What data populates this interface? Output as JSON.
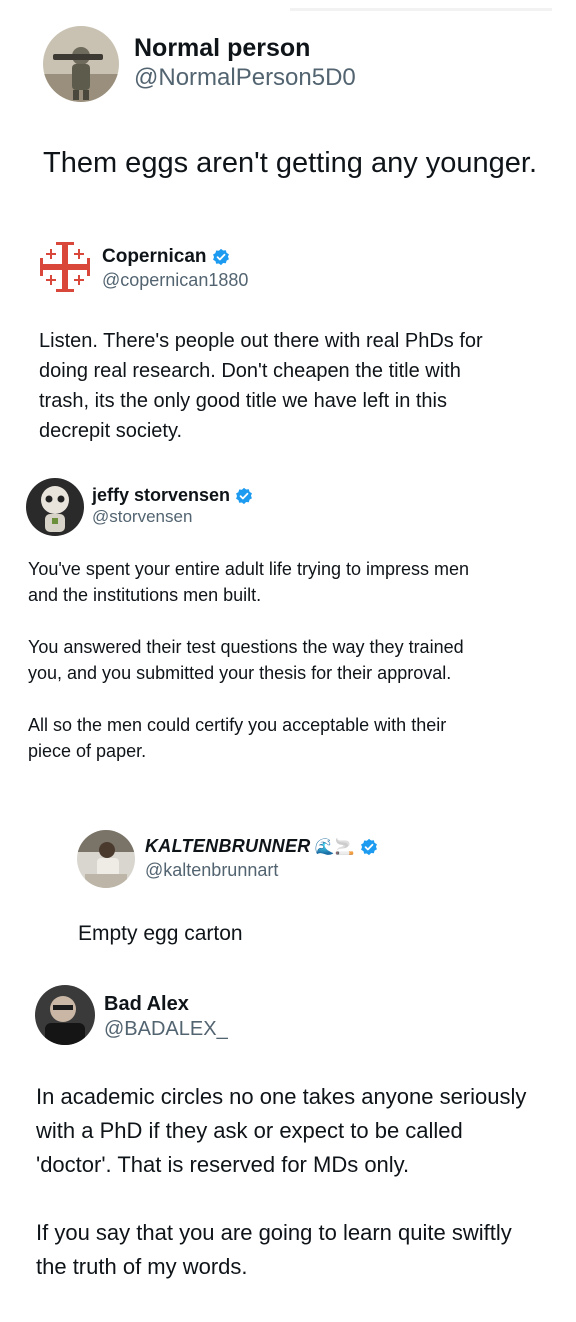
{
  "tweets": [
    {
      "name": "Normal person",
      "handle": "@NormalPerson5D0",
      "verified": false,
      "text": [
        "Them eggs aren't getting any younger."
      ]
    },
    {
      "name": "Copernican",
      "handle": "@copernican1880",
      "verified": true,
      "text": [
        "Listen. There's people out there with real PhDs for doing real research. Don't cheapen the title with trash, its the only good title we have left in this decrepit society."
      ]
    },
    {
      "name": "jeffy storvensen",
      "handle": "@storvensen",
      "verified": true,
      "text": [
        "You've spent your entire adult life trying to impress men and the institutions men built.",
        "You answered their test questions the way they trained you, and you submitted your thesis for their approval.",
        "All so the men could certify you acceptable with their piece of paper."
      ]
    },
    {
      "name": "KALTENBRUNNER",
      "name_emojis": "🌊🚬",
      "handle": "@kaltenbrunnart",
      "verified": true,
      "text": [
        "Empty egg carton"
      ]
    },
    {
      "name": "Bad Alex",
      "handle": "@BADALEX_",
      "verified": false,
      "text": [
        "In academic circles no one takes anyone seriously with a PhD if they ask or expect to be called 'doctor'. That is reserved for MDs only.",
        "If you say that you are going to learn quite swiftly the truth of my words."
      ]
    }
  ],
  "icons": {
    "verified_badge": "verified-badge-icon",
    "badge_color": "#1d9bf0",
    "cross_color": "#d9473b"
  }
}
